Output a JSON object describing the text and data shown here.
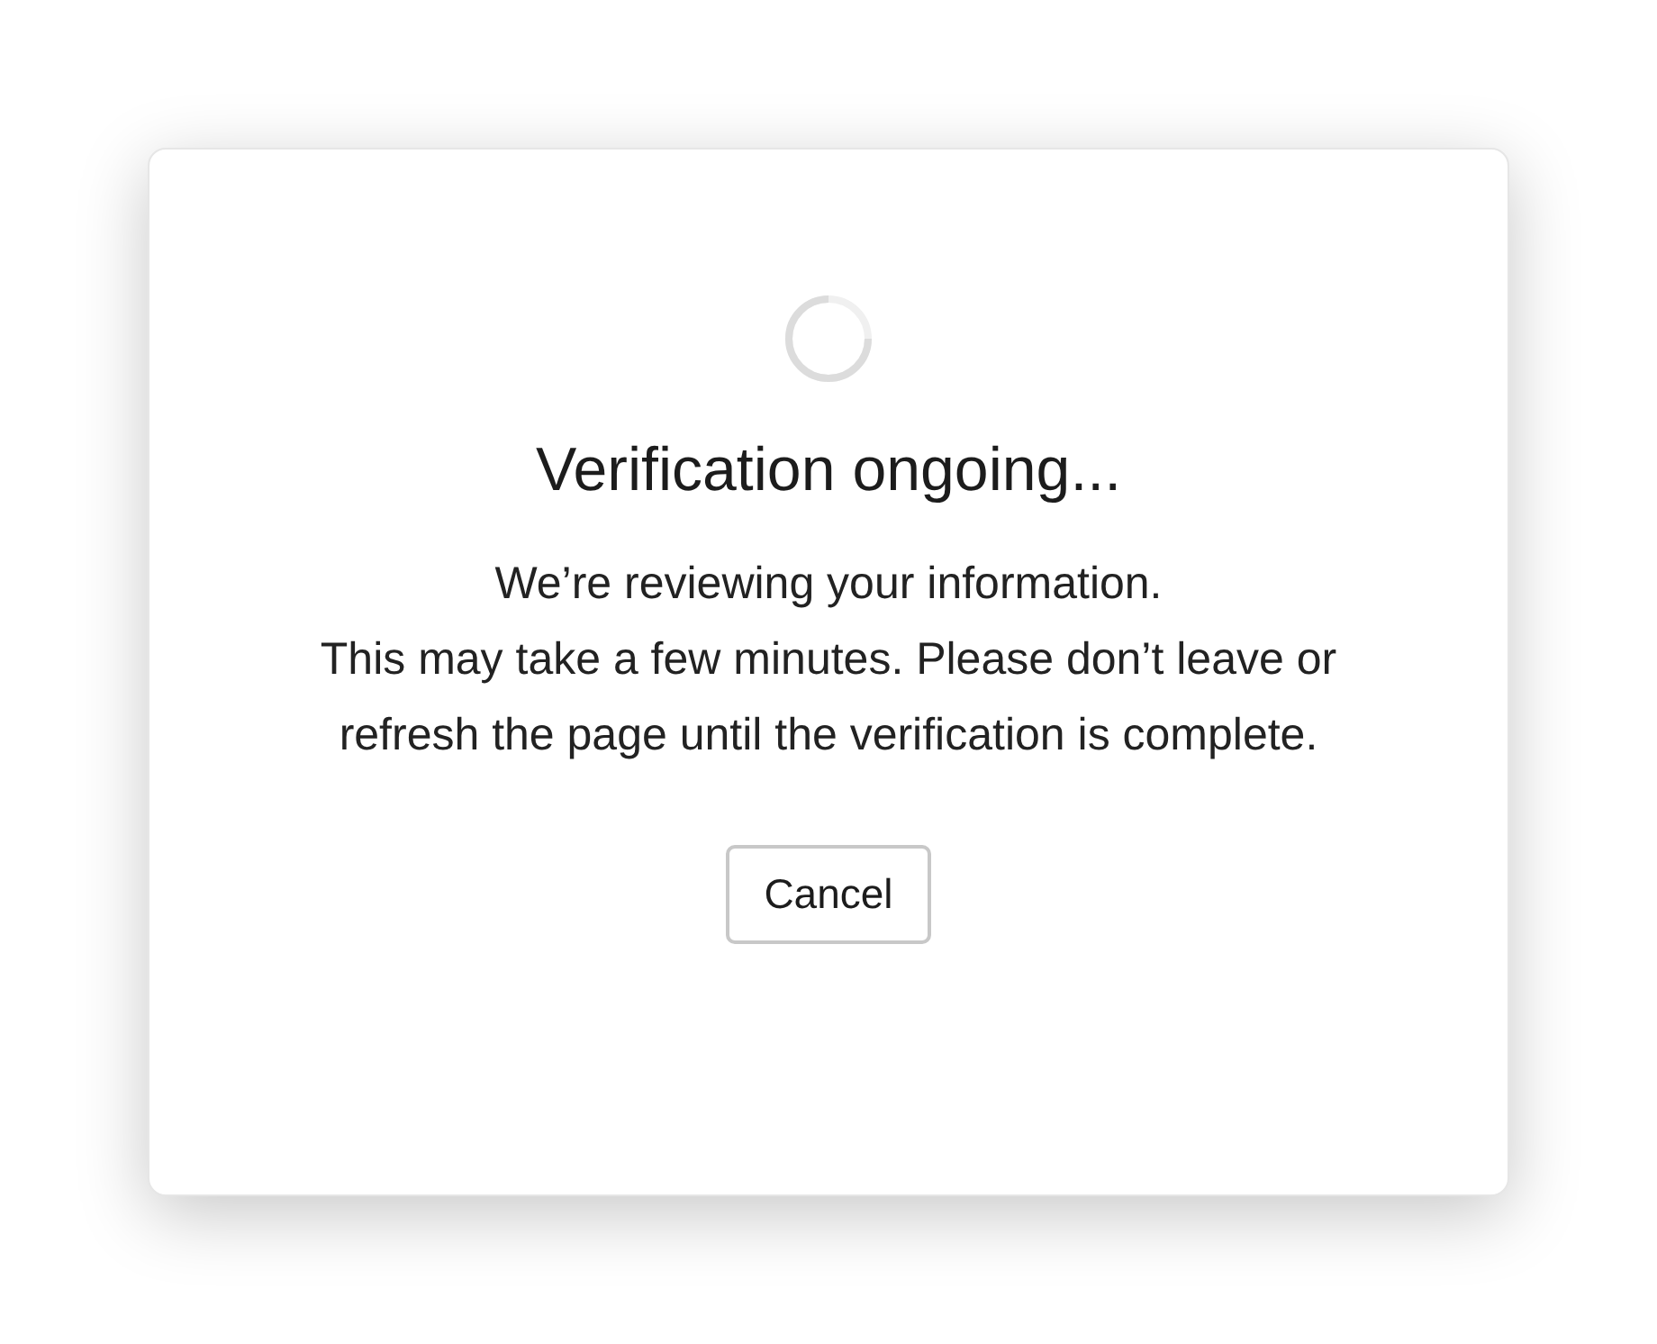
{
  "dialog": {
    "title": "Verification ongoing...",
    "message": [
      "We’re reviewing your information.",
      "This may take a few minutes. Please don’t leave or refresh the page until the verification is complete."
    ],
    "buttons": [
      "Cancel"
    ]
  }
}
